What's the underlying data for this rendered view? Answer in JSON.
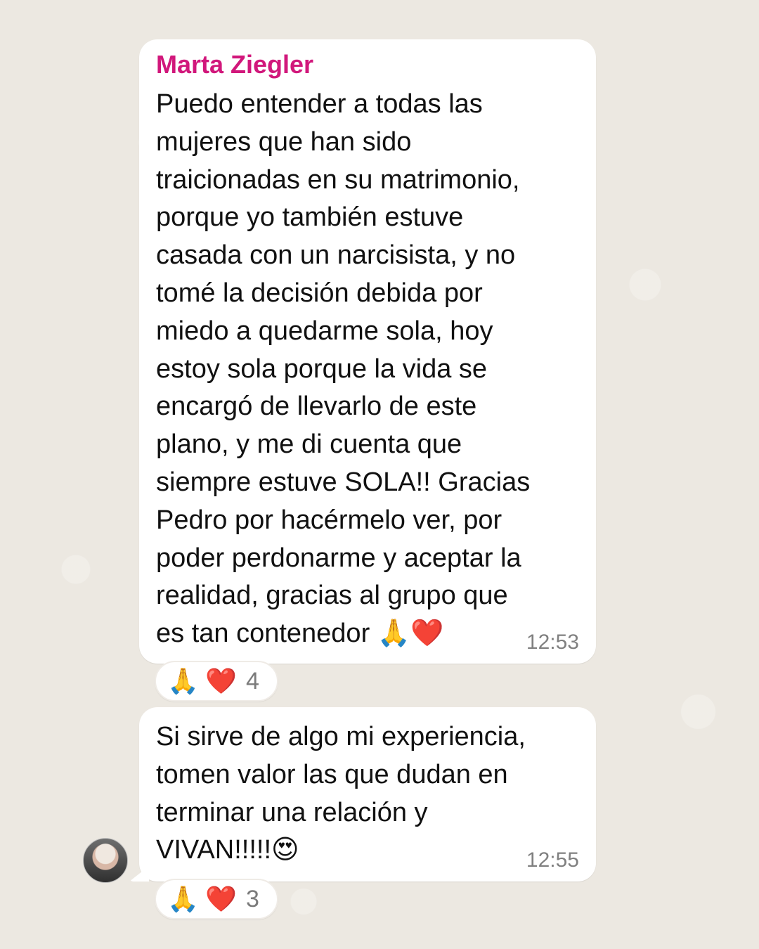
{
  "messages": [
    {
      "sender": "Marta Ziegler",
      "text": "Puedo entender a todas las\nmujeres que han sido\ntraicionadas en su matrimonio,\nporque yo también estuve\ncasada con un narcisista, y no\ntomé la decisión debida por\nmiedo a quedarme sola, hoy\nestoy sola porque la vida se\nencargó de llevarlo de este\nplano, y me di cuenta que\nsiempre estuve SOLA!! Gracias\nPedro por hacérmelo ver, por\npoder perdonarme y aceptar la\nrealidad, gracias al grupo que\nes tan contenedor 🙏❤️",
      "time": "12:53",
      "reactions": {
        "icon1": "🙏",
        "icon2": "❤️",
        "count": "4"
      }
    },
    {
      "sender": "",
      "text": "Si sirve de algo mi experiencia,\ntomen valor las que dudan en\nterminar una relación y\nVIVAN!!!!!😍",
      "time": "12:55",
      "reactions": {
        "icon1": "🙏",
        "icon2": "❤️",
        "count": "3"
      }
    }
  ],
  "avatar": {
    "icon_name": "user-avatar"
  },
  "colors": {
    "background": "#ece8e1",
    "bubble": "#ffffff",
    "sender_name": "#d1177b",
    "text": "#111111",
    "timestamp": "#808080"
  }
}
